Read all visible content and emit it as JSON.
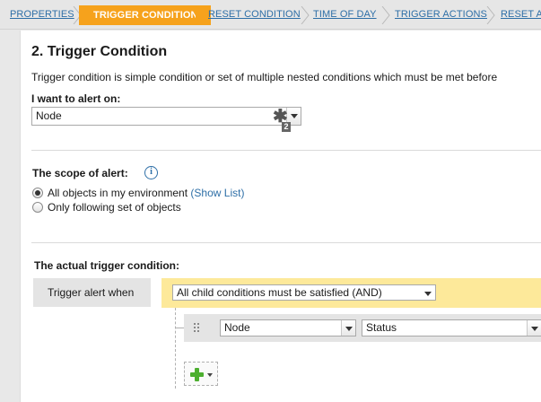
{
  "wizard": {
    "steps": [
      {
        "label": "PROPERTIES",
        "active": false
      },
      {
        "label": "TRIGGER CONDITION",
        "active": true
      },
      {
        "label": "RESET CONDITION",
        "active": false
      },
      {
        "label": "TIME OF DAY",
        "active": false
      },
      {
        "label": "TRIGGER ACTIONS",
        "active": false
      },
      {
        "label": "RESET A",
        "active": false
      }
    ],
    "active_color": "#f6a21c",
    "link_color": "#2e6fa7"
  },
  "page": {
    "title": "2. Trigger Condition",
    "description": "Trigger condition is simple condition or set of multiple nested conditions which must be met before"
  },
  "alert_on": {
    "label": "I want to alert on:",
    "value": "Node",
    "badge_icon": "asterisk-icon",
    "badge_sub": "2"
  },
  "scope": {
    "label": "The scope of alert:",
    "info_icon": "info-icon",
    "options": [
      {
        "label": "All objects in my environment",
        "link": "(Show List)",
        "checked": true
      },
      {
        "label": "Only following set of objects",
        "checked": false
      }
    ]
  },
  "actual": {
    "label": "The actual trigger condition:",
    "trigger_when": "Trigger alert when",
    "group_select": "All child conditions must be satisfied (AND)",
    "group_bar_color": "#fde99a",
    "condition": {
      "object_select": "Node",
      "field_select": "Status"
    },
    "add_icon": "plus-icon"
  }
}
